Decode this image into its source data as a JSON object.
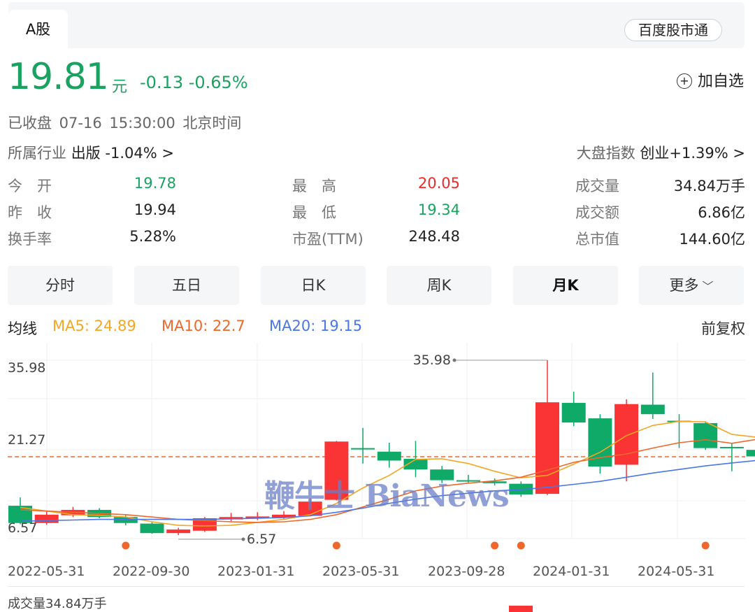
{
  "tabs": {
    "a_share": "A股",
    "stock_connect": "百度股市通"
  },
  "quote": {
    "price": "19.81",
    "unit": "元",
    "change": "-0.13 -0.65%",
    "add_watch": "加自选",
    "status": "已收盘  07-16 15:30:00  北京时间",
    "industry_label": "所属行业",
    "industry_name": "出版",
    "industry_change": "-1.04% >",
    "market_label": "大盘指数",
    "market_name": "创业",
    "market_change": "+1.39% >"
  },
  "stats": [
    {
      "label": "今　开",
      "value": "19.78",
      "color": "green"
    },
    {
      "label": "最　高",
      "value": "20.05",
      "color": "red"
    },
    {
      "label": "成交量",
      "value": "34.84万手",
      "color": "none"
    },
    {
      "label": "昨　收",
      "value": "19.94",
      "color": "none"
    },
    {
      "label": "最　低",
      "value": "19.34",
      "color": "green"
    },
    {
      "label": "成交额",
      "value": "6.86亿",
      "color": "none"
    },
    {
      "label": "换手率",
      "value": "5.28%",
      "color": "none"
    },
    {
      "label": "市盈(TTM)",
      "value": "248.48",
      "color": "none"
    },
    {
      "label": "总市值",
      "value": "144.60亿",
      "color": "none"
    }
  ],
  "ktabs": [
    "分时",
    "五日",
    "日K",
    "周K",
    "月K",
    "更多"
  ],
  "ktab_active": 4,
  "ma": {
    "label": "均线",
    "ma5": "MA5: 24.89",
    "ma10": "MA10: 22.7",
    "ma20": "MA20: 19.15",
    "adjust": "前复权",
    "colors": {
      "ma5": "#f5a623",
      "ma10": "#f0672b",
      "ma20": "#4a76e8"
    }
  },
  "watermark": "鞭牛士 BiaNews",
  "colors": {
    "up": "#fa3434",
    "down": "#0fa968",
    "green_text": "#1aa260"
  },
  "chart_data": {
    "type": "candlestick",
    "y_ticks": [
      "35.98",
      "21.27",
      "6.57"
    ],
    "ylim": [
      6.57,
      35.98
    ],
    "max_label": "35.98",
    "min_label": "6.57",
    "current_price": 19.81,
    "x_labels": [
      "2022-05-31",
      "2022-09-30",
      "2023-01-31",
      "2023-05-31",
      "2023-09-28",
      "2024-01-31",
      "2024-05-31"
    ],
    "candles": [
      {
        "o": 11.5,
        "c": 8.6,
        "h": 12.9,
        "l": 8.4
      },
      {
        "o": 8.6,
        "c": 10.0,
        "h": 10.5,
        "l": 8.3
      },
      {
        "o": 9.9,
        "c": 10.8,
        "h": 11.3,
        "l": 9.6
      },
      {
        "o": 10.8,
        "c": 9.6,
        "h": 11.1,
        "l": 9.4
      },
      {
        "o": 9.6,
        "c": 8.6,
        "h": 9.9,
        "l": 8.2
      },
      {
        "o": 8.5,
        "c": 6.9,
        "h": 8.8,
        "l": 6.8
      },
      {
        "o": 6.9,
        "c": 7.5,
        "h": 7.8,
        "l": 6.57
      },
      {
        "o": 7.3,
        "c": 9.4,
        "h": 9.6,
        "l": 7.1
      },
      {
        "o": 9.2,
        "c": 9.6,
        "h": 10.3,
        "l": 8.9
      },
      {
        "o": 9.4,
        "c": 9.7,
        "h": 10.4,
        "l": 9.1
      },
      {
        "o": 9.5,
        "c": 10.0,
        "h": 10.6,
        "l": 9.3
      },
      {
        "o": 9.8,
        "c": 12.2,
        "h": 12.8,
        "l": 9.7
      },
      {
        "o": 12.5,
        "c": 22.3,
        "h": 22.4,
        "l": 12.4
      },
      {
        "o": 21.2,
        "c": 21.0,
        "h": 24.6,
        "l": 18.6
      },
      {
        "o": 20.6,
        "c": 19.1,
        "h": 22.1,
        "l": 17.9
      },
      {
        "o": 19.4,
        "c": 17.6,
        "h": 22.4,
        "l": 16.3
      },
      {
        "o": 17.6,
        "c": 15.8,
        "h": 18.2,
        "l": 15.3
      },
      {
        "o": 15.8,
        "c": 15.6,
        "h": 16.7,
        "l": 15.4
      },
      {
        "o": 15.6,
        "c": 15.3,
        "h": 16.1,
        "l": 14.9
      },
      {
        "o": 15.2,
        "c": 13.4,
        "h": 15.6,
        "l": 13.0
      },
      {
        "o": 13.5,
        "c": 28.9,
        "h": 35.98,
        "l": 13.3
      },
      {
        "o": 28.8,
        "c": 25.5,
        "h": 30.7,
        "l": 24.9
      },
      {
        "o": 26.2,
        "c": 18.1,
        "h": 26.9,
        "l": 16.9
      },
      {
        "o": 18.4,
        "c": 28.6,
        "h": 29.4,
        "l": 15.6
      },
      {
        "o": 28.5,
        "c": 26.9,
        "h": 33.9,
        "l": 26.1
      },
      {
        "o": 25.8,
        "c": 25.6,
        "h": 26.9,
        "l": 21.2
      },
      {
        "o": 25.4,
        "c": 21.2,
        "h": 25.7,
        "l": 20.9
      },
      {
        "o": 21.4,
        "c": 21.3,
        "h": 22.1,
        "l": 17.3
      },
      {
        "o": 20.9,
        "c": 19.8,
        "h": 21.2,
        "l": 19.3
      }
    ],
    "ma5": [
      11.2,
      10.6,
      10.0,
      9.9,
      9.6,
      8.8,
      8.2,
      8.1,
      8.2,
      8.7,
      9.2,
      10.0,
      11.9,
      14.5,
      16.6,
      19.3,
      19.4,
      18.6,
      17.3,
      16.2,
      16.6,
      18.5,
      20.5,
      23.3,
      25.0,
      25.7,
      25.6,
      23.5,
      23.0
    ],
    "ma10": [
      10.8,
      10.6,
      10.4,
      10.2,
      10.0,
      9.6,
      9.2,
      9.0,
      8.8,
      8.7,
      8.8,
      9.2,
      10.0,
      11.3,
      12.6,
      14.0,
      14.8,
      15.3,
      15.7,
      16.3,
      17.5,
      18.8,
      19.6,
      20.2,
      21.2,
      22.1,
      22.6,
      22.0,
      22.7
    ],
    "ma20": [
      8.9,
      9.0,
      9.1,
      9.2,
      9.2,
      9.2,
      9.2,
      9.2,
      9.3,
      9.4,
      9.5,
      9.8,
      10.4,
      11.1,
      11.9,
      12.6,
      13.2,
      13.6,
      14.0,
      14.2,
      14.6,
      15.1,
      15.6,
      16.3,
      17.0,
      17.6,
      18.2,
      18.7,
      19.15
    ],
    "markers": [
      4,
      12,
      18,
      19,
      26
    ]
  }
}
